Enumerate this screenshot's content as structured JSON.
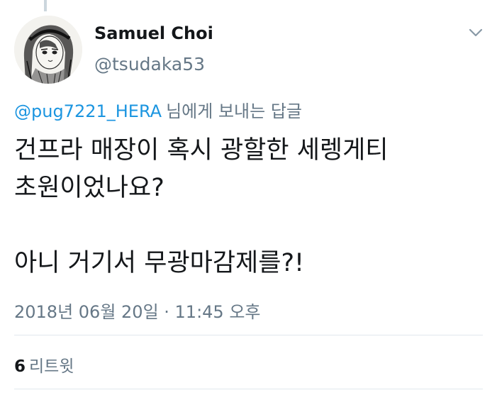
{
  "tweet": {
    "author": {
      "display_name": "Samuel Choi",
      "handle": "@tsudaka53",
      "avatar_icon": "manga-drawing-avatar"
    },
    "reply_to": {
      "mention": "@pug7221_HERA",
      "suffix": "님에게 보내는 답글"
    },
    "text_lines": [
      "건프라 매장이 혹시 광할한 세렝게티",
      "초원이었나요?",
      "아니 거기서 무광마감제를?!"
    ],
    "timestamp": "2018년 06월 20일 · 11:45 오후",
    "stats": {
      "retweet_count": "6",
      "retweet_label": "리트윗"
    }
  },
  "icons": {
    "menu_caret": "chevron-down-icon"
  },
  "colors": {
    "link_blue": "#1b95e0",
    "secondary_gray": "#657786",
    "text_dark": "#14171a",
    "divider": "#e1e8ed"
  }
}
